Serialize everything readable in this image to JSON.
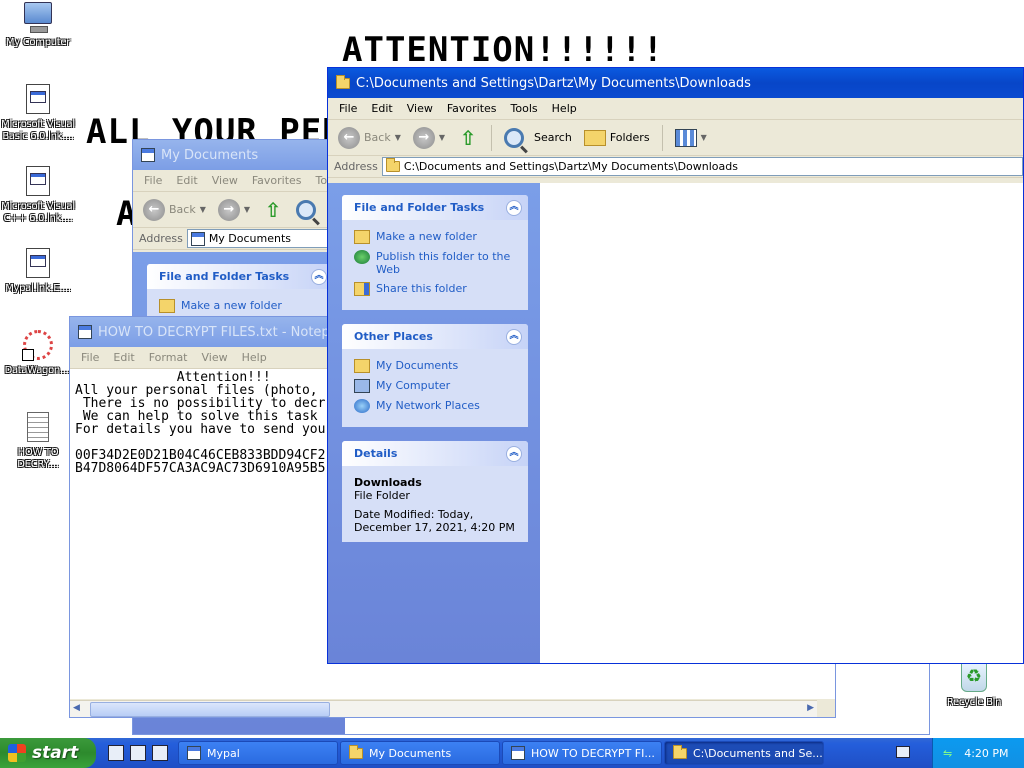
{
  "desktop": {
    "icons": [
      {
        "label": "My Computer"
      },
      {
        "label": "Microsoft Visual Basic 6.0.lnk...."
      },
      {
        "label": "Microsoft Visual C++ 6.0.lnk...."
      },
      {
        "label": "Mypal.lnk.E...."
      },
      {
        "label": "DataWagon...."
      },
      {
        "label": "HOW TO DECRY...."
      },
      {
        "label": "Recycle Bin"
      }
    ],
    "ransom_line1": "ATTENTION!!!!!!",
    "ransom_line2": "ALL YOUR PER",
    "ransom_line3": "A"
  },
  "win_downloads": {
    "title": "C:\\Documents and Settings\\Dartz\\My Documents\\Downloads",
    "menu": [
      "File",
      "Edit",
      "View",
      "Favorites",
      "Tools",
      "Help"
    ],
    "back": "Back",
    "search": "Search",
    "folders": "Folders",
    "address_label": "Address",
    "address_value": "C:\\Documents and Settings\\Dartz\\My Documents\\Downloads",
    "file_tasks": {
      "header": "File and Folder Tasks",
      "items": [
        "Make a new folder",
        "Publish this folder to the Web",
        "Share this folder"
      ]
    },
    "other_places": {
      "header": "Other Places",
      "items": [
        "My Documents",
        "My Computer",
        "My Network Places"
      ]
    },
    "details": {
      "header": "Details",
      "name": "Downloads",
      "type": "File Folder",
      "modified": "Date Modified: Today, December 17, 2021, 4:20 PM"
    }
  },
  "win_mydocs": {
    "title": "My Documents",
    "menu": [
      "File",
      "Edit",
      "View",
      "Favorites",
      "Too"
    ],
    "back": "Back",
    "address_label": "Address",
    "address_value": "My Documents",
    "task_header": "File and Folder Tasks",
    "task_item": "Make a new folder"
  },
  "win_notepad": {
    "title": "HOW TO DECRYPT FILES.txt - Notepad",
    "menu": [
      "File",
      "Edit",
      "Format",
      "View",
      "Help"
    ],
    "lines": [
      "             Attention!!!",
      "All your personal files (photo,",
      " There is no possibility to decr",
      " We can help to solve this task",
      "For details you have to send you",
      "",
      "00F34D2E0D21B04C46CEB833BDD94CF2",
      "B47D8064DF57CA3AC9AC73D6910A95B5"
    ]
  },
  "taskbar": {
    "start": "start",
    "buttons": [
      "Mypal",
      "My Documents",
      "HOW TO DECRYPT FI...",
      "C:\\Documents and Se..."
    ],
    "clock": "4:20 PM"
  }
}
